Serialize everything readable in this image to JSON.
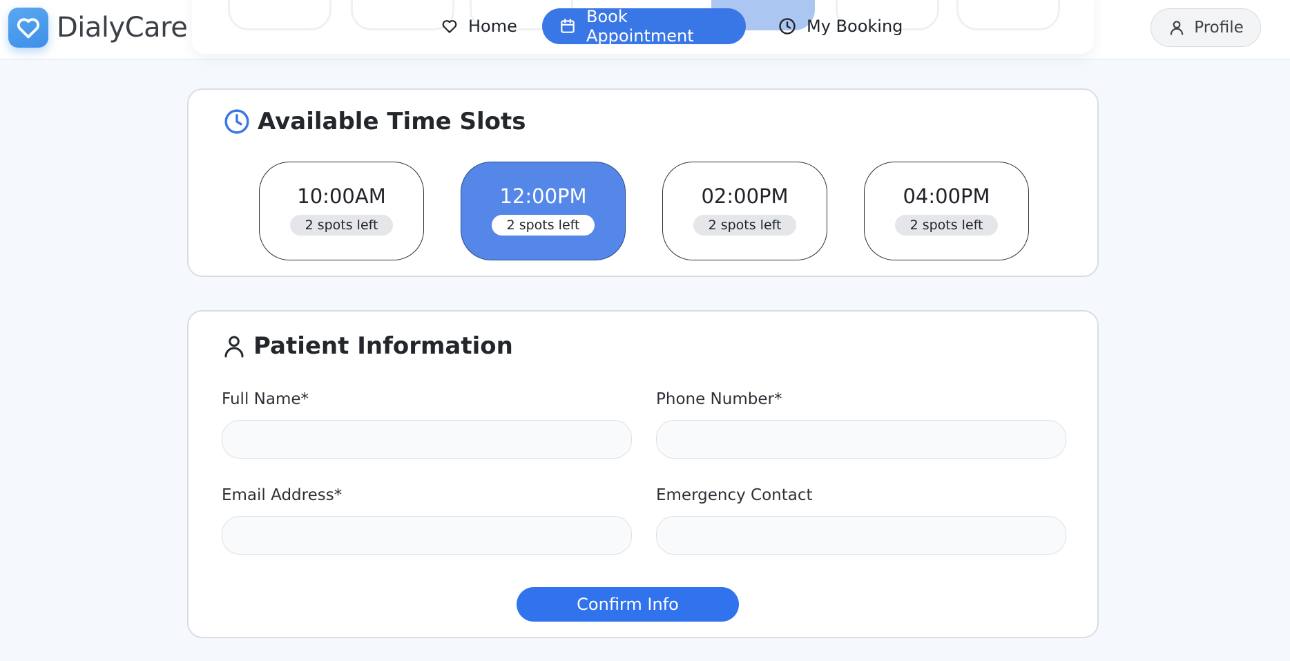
{
  "brand": {
    "name": "DialyCare",
    "logo_icon": "heart-icon",
    "accent": "#3d8fe8"
  },
  "nav": {
    "items": [
      {
        "label": "Home",
        "icon": "heart-outline-icon",
        "active": false
      },
      {
        "label": "Book Appointment",
        "icon": "calendar-icon",
        "active": true
      },
      {
        "label": "My Booking",
        "icon": "clock-icon",
        "active": false
      }
    ],
    "active_color": "#3a77e6"
  },
  "profile": {
    "label": "Profile",
    "icon": "user-icon"
  },
  "time_slots": {
    "title": "Available Time Slots",
    "title_icon": "clock-icon",
    "slots": [
      {
        "time": "10:00AM",
        "spots": "2 spots left",
        "selected": false
      },
      {
        "time": "12:00PM",
        "spots": "2 spots left",
        "selected": true
      },
      {
        "time": "02:00PM",
        "spots": "2 spots left",
        "selected": false
      },
      {
        "time": "04:00PM",
        "spots": "2 spots left",
        "selected": false
      }
    ],
    "selected_color": "#5587e8"
  },
  "patient": {
    "title": "Patient Information",
    "title_icon": "user-icon",
    "fields": {
      "full_name": {
        "label": "Full Name*",
        "value": ""
      },
      "phone": {
        "label": "Phone Number*",
        "value": ""
      },
      "email": {
        "label": "Email Address*",
        "value": ""
      },
      "emergency": {
        "label": "Emergency Contact",
        "value": ""
      }
    },
    "confirm_label": "Confirm Info",
    "button_color": "#3173ec"
  }
}
